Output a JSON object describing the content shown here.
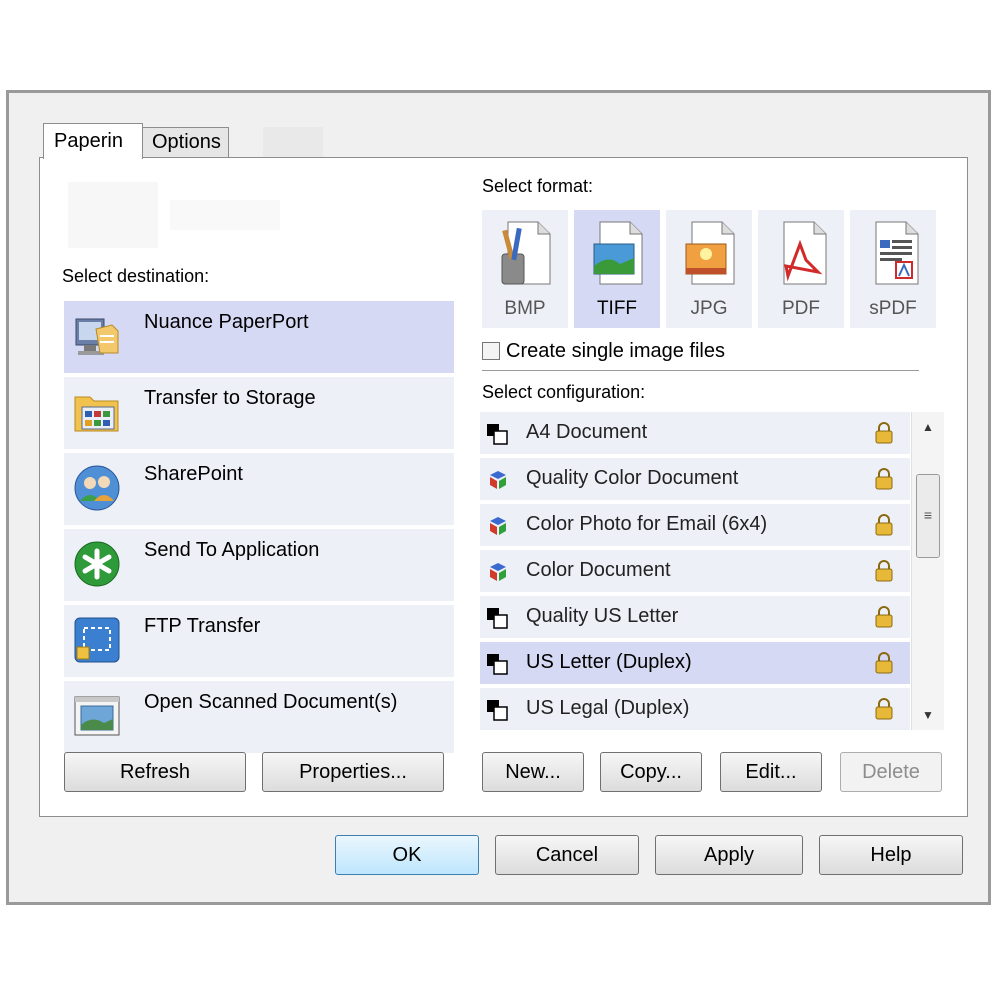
{
  "tabs": [
    {
      "label": "Paperin"
    },
    {
      "label": "Options"
    }
  ],
  "destination": {
    "heading": "Select destination:",
    "items": [
      {
        "label": "Nuance PaperPort",
        "icon": "paperport-icon",
        "selected": true
      },
      {
        "label": "Transfer to Storage",
        "icon": "storage-folder-icon",
        "selected": false
      },
      {
        "label": "SharePoint",
        "icon": "sharepoint-icon",
        "selected": false
      },
      {
        "label": "Send To Application",
        "icon": "send-to-application-icon",
        "selected": false
      },
      {
        "label": "FTP Transfer",
        "icon": "ftp-transfer-icon",
        "selected": false
      },
      {
        "label": "Open Scanned Document(s)",
        "icon": "open-document-icon",
        "selected": false
      }
    ],
    "buttons": {
      "refresh": "Refresh",
      "properties": "Properties..."
    }
  },
  "format": {
    "heading": "Select format:",
    "options": [
      {
        "label": "BMP",
        "icon": "bmp-icon",
        "selected": false
      },
      {
        "label": "TIFF",
        "icon": "tiff-icon",
        "selected": true
      },
      {
        "label": "JPG",
        "icon": "jpg-icon",
        "selected": false
      },
      {
        "label": "PDF",
        "icon": "pdf-icon",
        "selected": false
      },
      {
        "label": "sPDF",
        "icon": "spdf-icon",
        "selected": false
      }
    ],
    "single_image_label": "Create single image files",
    "single_image_checked": false
  },
  "configuration": {
    "heading": "Select configuration:",
    "items": [
      {
        "label": "A4 Document",
        "icon": "bw-document-icon",
        "selected": false
      },
      {
        "label": "Quality Color Document",
        "icon": "color-document-icon",
        "selected": false
      },
      {
        "label": "Color Photo for Email (6x4)",
        "icon": "color-document-icon",
        "selected": false
      },
      {
        "label": "Color Document",
        "icon": "color-document-icon",
        "selected": false
      },
      {
        "label": "Quality US Letter",
        "icon": "bw-document-icon",
        "selected": false
      },
      {
        "label": "US Letter (Duplex)",
        "icon": "bw-document-icon",
        "selected": true
      },
      {
        "label": "US Legal (Duplex)",
        "icon": "bw-document-icon",
        "selected": false
      }
    ],
    "buttons": {
      "new": "New...",
      "copy": "Copy...",
      "edit": "Edit...",
      "delete": "Delete"
    }
  },
  "dialog_buttons": {
    "ok": "OK",
    "cancel": "Cancel",
    "apply": "Apply",
    "help": "Help"
  },
  "colors": {
    "selected_row": "#d6d9f3",
    "row": "#eef0f8",
    "dialog_bg": "#f0f0f0",
    "lock": "#e0b040"
  }
}
